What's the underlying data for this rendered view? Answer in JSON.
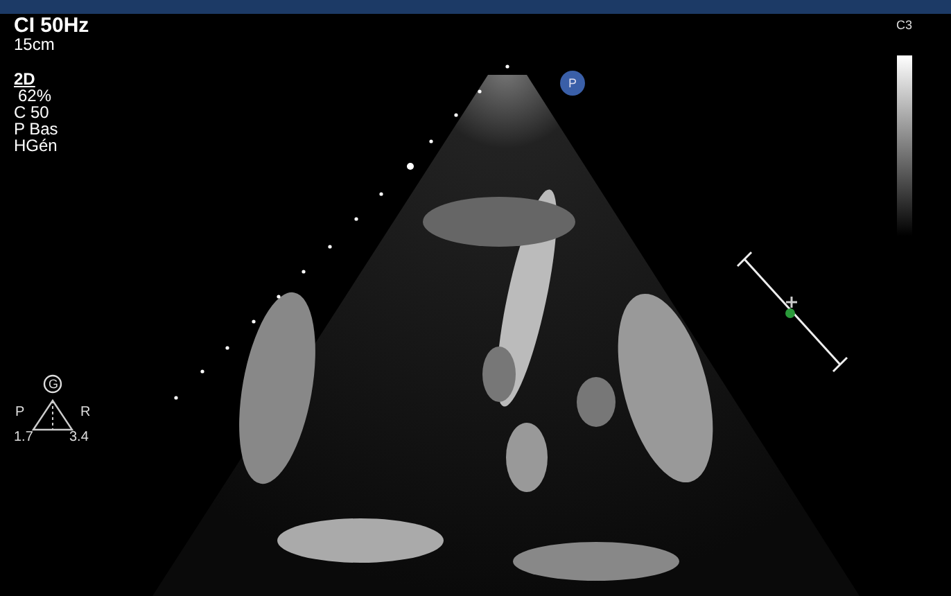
{
  "settings": {
    "frequency": "CI 50Hz",
    "depth": "15cm"
  },
  "mode": {
    "name": "2D",
    "gain": "62%",
    "compression": "C 50",
    "power": "P Bas",
    "harmonic": "HGén"
  },
  "probe_marker": "P",
  "color_map": "C3",
  "orientation": {
    "symbol": "G",
    "left": "P",
    "right": "R",
    "left_value": "1.7",
    "right_value": "3.4"
  }
}
